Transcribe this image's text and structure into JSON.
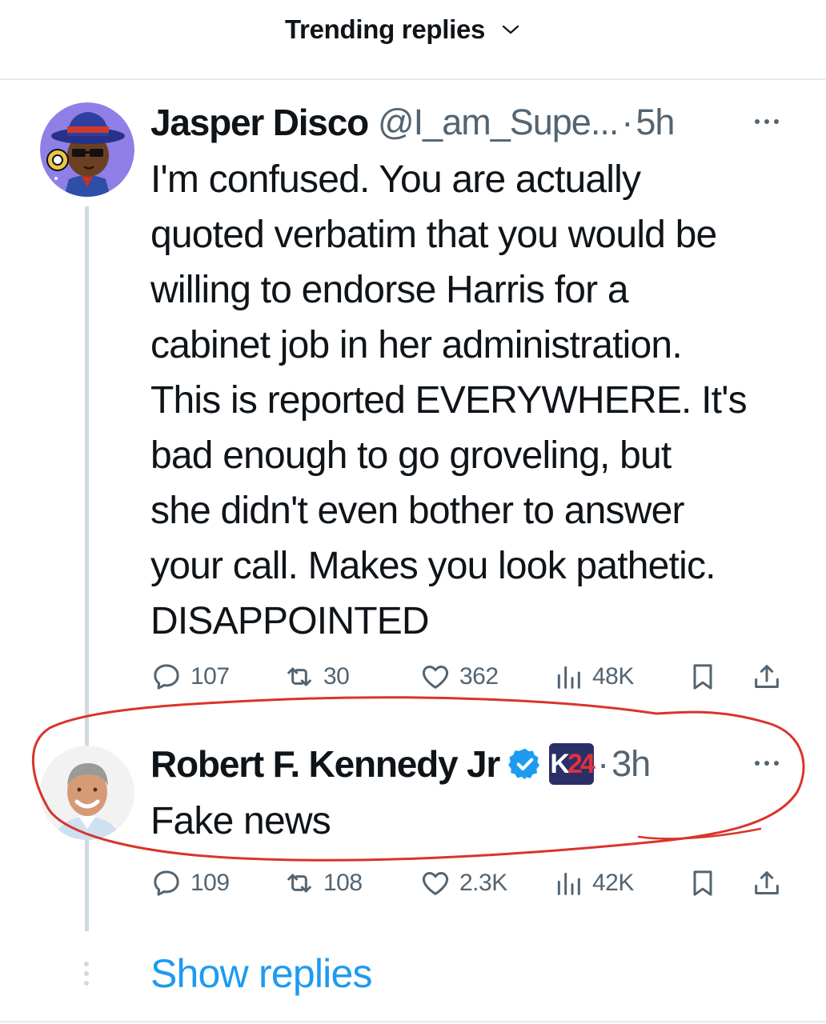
{
  "header": {
    "sort_label": "Trending replies",
    "sort_icon": "chevron-down-icon"
  },
  "tweets": [
    {
      "name": "Jasper Disco",
      "handle": "@I_am_Supe...",
      "separator": "·",
      "time": "5h",
      "avatar": "cartoon-character-avatar",
      "body_lines": [
        "I'm confused. You are actually",
        "quoted verbatim that you would be",
        "willing to endorse Harris for a",
        "cabinet job in her administration.",
        "This is reported EVERYWHERE. It's",
        "bad enough to go groveling, but",
        "she didn't even bother to answer",
        "your call. Makes you look pathetic.",
        "DISAPPOINTED"
      ],
      "stats": {
        "replies": "107",
        "reposts": "30",
        "likes": "362",
        "views": "48K"
      }
    },
    {
      "name": "Robert F. Kennedy Jr",
      "verified_icon": "verified-badge-icon",
      "affiliate_badge": {
        "left": "K",
        "right": "24"
      },
      "separator": "·",
      "time": "3h",
      "avatar": "profile-photo-avatar",
      "body_lines": [
        "Fake news"
      ],
      "stats": {
        "replies": "109",
        "reposts": "108",
        "likes": "2.3K",
        "views": "42K"
      }
    }
  ],
  "show_replies": "Show replies",
  "colors": {
    "accent": "#1d9bf0",
    "text": "#0f1419",
    "muted": "#536471",
    "annotation": "#d9342b"
  }
}
